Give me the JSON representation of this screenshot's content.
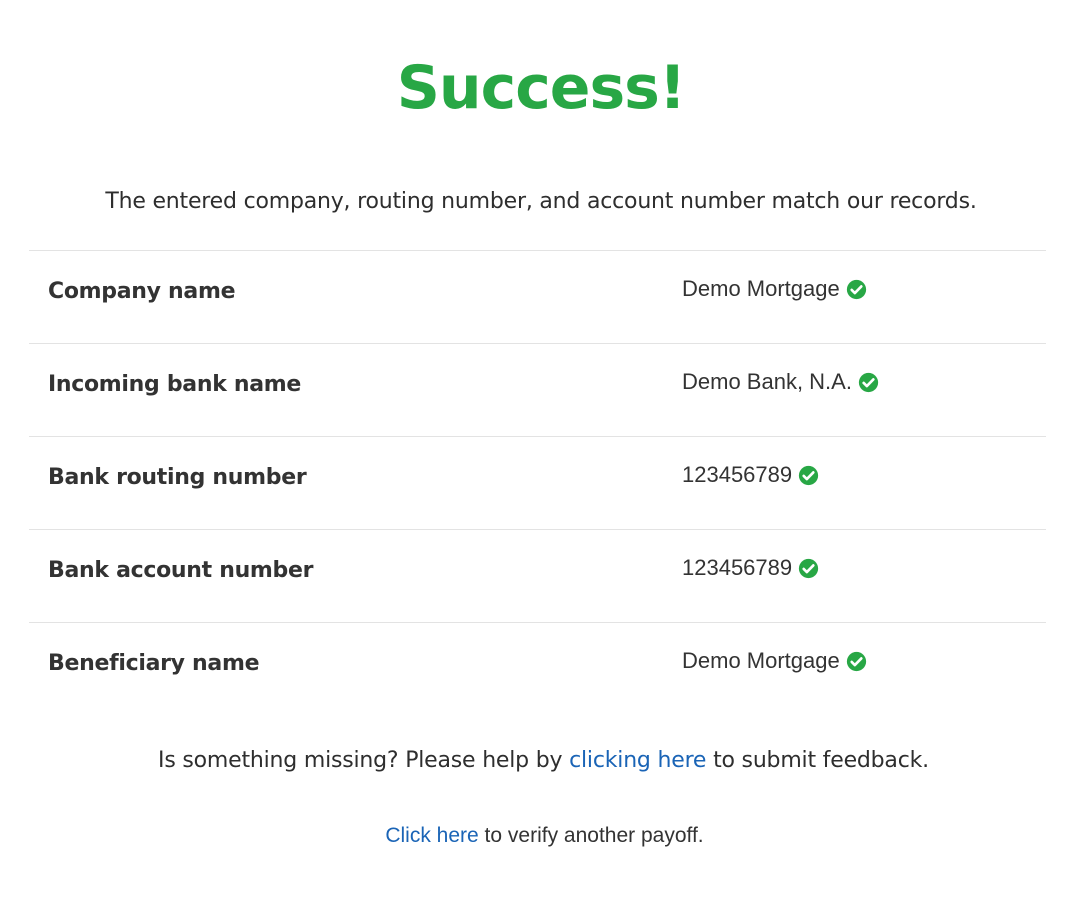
{
  "colors": {
    "success": "#28a745",
    "link": "#1a64b6",
    "text": "#333333",
    "divider": "#e3e3e3"
  },
  "header": {
    "title": "Success!",
    "message": "The entered company, routing number, and account number match our records."
  },
  "results": {
    "rows": [
      {
        "label": "Company name",
        "value": "Demo Mortgage",
        "icon": "check-circle-icon"
      },
      {
        "label": "Incoming bank name",
        "value": "Demo Bank, N.A.",
        "icon": "check-circle-icon"
      },
      {
        "label": "Bank routing number",
        "value": "123456789",
        "icon": "check-circle-icon"
      },
      {
        "label": "Bank account number",
        "value": "123456789",
        "icon": "check-circle-icon"
      },
      {
        "label": "Beneficiary name",
        "value": "Demo Mortgage",
        "icon": "check-circle-icon"
      }
    ]
  },
  "footer": {
    "feedback_prefix": "Is something missing? Please help by ",
    "feedback_link": "clicking here",
    "feedback_suffix": " to submit feedback.",
    "verify_link": "Click here",
    "verify_suffix": " to verify another payoff."
  }
}
